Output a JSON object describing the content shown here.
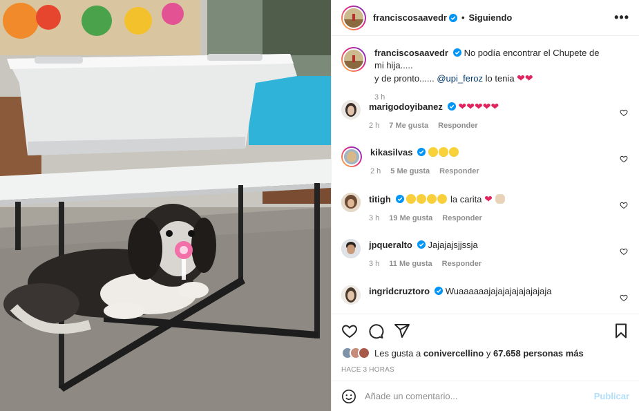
{
  "header": {
    "username": "franciscosaavedr",
    "separator": "•",
    "follow_status": "Siguiendo",
    "more": "•••"
  },
  "caption": {
    "username": "franciscosaavedr",
    "text_line1": "No podía encontrar el Chupete de mi hija.....",
    "text_line2a": "y de pronto...... ",
    "mention": "@upi_feroz",
    "text_line2b": " lo tenia ",
    "emoji": "❤❤",
    "time": "3 h"
  },
  "comments": [
    {
      "username": "marigodoyibanez",
      "text": "❤❤❤❤❤",
      "time": "2 h",
      "likes": "7 Me gusta",
      "reply": "Responder"
    },
    {
      "username": "kikasilvas",
      "text": "",
      "time": "2 h",
      "likes": "5 Me gusta",
      "reply": "Responder"
    },
    {
      "username": "titigh",
      "text": " la carita ",
      "heart": "❤",
      "time": "3 h",
      "likes": "19 Me gusta",
      "reply": "Responder"
    },
    {
      "username": "jpqueralto",
      "text": "Jajajajsjjssja",
      "time": "3 h",
      "likes": "11 Me gusta",
      "reply": "Responder"
    },
    {
      "username": "ingridcruztoro",
      "text": "Wuaaaaaajajajajajajajajaja",
      "time": "",
      "likes": "",
      "reply": ""
    }
  ],
  "likes": {
    "prefix": "Les gusta a ",
    "user": "conivercellino",
    "middle": " y ",
    "count": "67.658 personas más"
  },
  "timestamp": "HACE 3 HORAS",
  "add_comment": {
    "placeholder": "Añade un comentario...",
    "publish": "Publicar"
  },
  "colors": {
    "verified": "#0095f6",
    "heart": "#e0245e",
    "publish": "#b2dffc",
    "mention": "#00376b"
  }
}
